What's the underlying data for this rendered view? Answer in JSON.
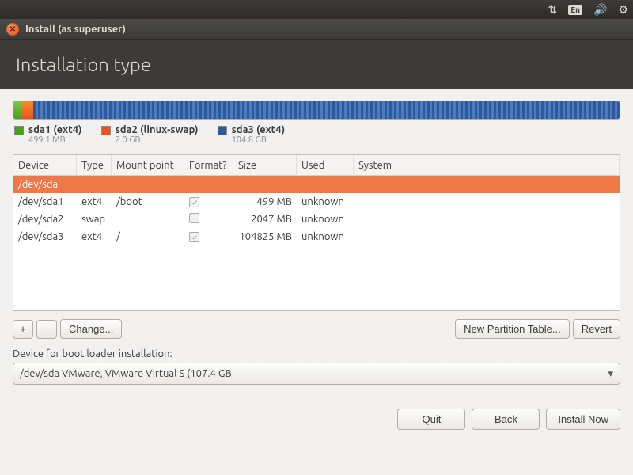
{
  "menubar": {
    "lang": "En"
  },
  "window": {
    "title": "Install (as superuser)"
  },
  "header": {
    "title": "Installation type"
  },
  "usage": {
    "seg1_pct": "1.2%",
    "seg2_pct": "2%"
  },
  "legend": [
    {
      "color": "#4aa01c",
      "label": "sda1 (ext4)",
      "sub": "499.1 MB"
    },
    {
      "color": "#e95420",
      "label": "sda2 (linux-swap)",
      "sub": "2.0 GB"
    },
    {
      "color": "#2e5a9c",
      "label": "sda3 (ext4)",
      "sub": "104.8 GB"
    }
  ],
  "table": {
    "headers": [
      "Device",
      "Type",
      "Mount point",
      "Format?",
      "Size",
      "Used",
      "System"
    ],
    "rows": [
      {
        "device": "/dev/sda",
        "type": "",
        "mount": "",
        "format": false,
        "size": "",
        "used": "",
        "system": "",
        "selected": true
      },
      {
        "device": "/dev/sda1",
        "type": "ext4",
        "mount": "/boot",
        "format": true,
        "size": "499 MB",
        "used": "unknown",
        "system": ""
      },
      {
        "device": "/dev/sda2",
        "type": "swap",
        "mount": "",
        "format": false,
        "size": "2047 MB",
        "used": "unknown",
        "system": ""
      },
      {
        "device": "/dev/sda3",
        "type": "ext4",
        "mount": "/",
        "format": true,
        "size": "104825 MB",
        "used": "unknown",
        "system": ""
      }
    ]
  },
  "toolbar": {
    "add": "+",
    "remove": "−",
    "change": "Change...",
    "new_table": "New Partition Table...",
    "revert": "Revert"
  },
  "boot": {
    "label": "Device for boot loader installation:",
    "value": "/dev/sda   VMware, VMware Virtual S (107.4 GB"
  },
  "footer": {
    "quit": "Quit",
    "back": "Back",
    "install": "Install Now"
  }
}
